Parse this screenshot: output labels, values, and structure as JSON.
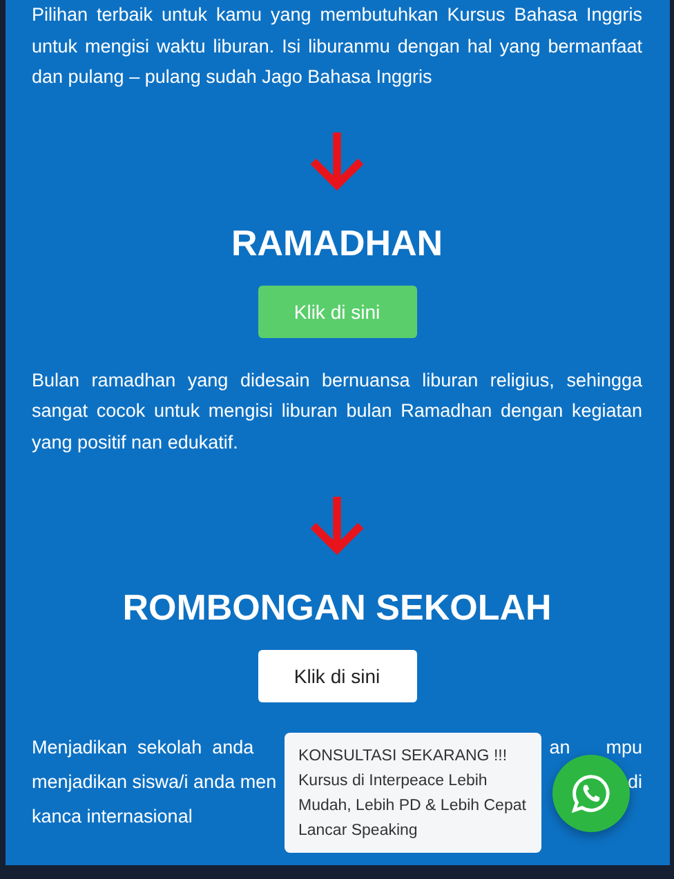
{
  "intro": {
    "text": "Pilihan terbaik untuk kamu yang membutuhkan Kursus Bahasa Inggris untuk mengisi waktu liburan. Isi liburanmu dengan hal yang bermanfaat dan pulang – pulang sudah Jago Bahasa Inggris"
  },
  "sections": [
    {
      "title": "RAMADHAN",
      "button": {
        "label": "Klik di sini",
        "kind": "green"
      },
      "paragraph": {
        "kind": "full",
        "text": "Bulan ramadhan yang didesain bernuansa liburan religius, sehingga sangat cocok untuk mengisi liburan bulan Ramadhan dengan kegiatan yang positif nan edukatif."
      }
    },
    {
      "title": "ROMBONGAN SEKOLAH",
      "button": {
        "label": "Klik di sini",
        "kind": "white"
      },
      "paragraph": {
        "kind": "covered",
        "lines": [
          {
            "left": "Menjadikan  sekolah  anda",
            "right": [
              "an",
              "mpu"
            ]
          },
          {
            "left": "menjadikan siswa/i anda men",
            "right": [
              "di"
            ]
          },
          {
            "left": "kanca internasional"
          }
        ]
      }
    }
  ],
  "chat_popup": {
    "lines": [
      "KONSULTASI SEKARANG !!!",
      "Kursus di Interpeace Lebih",
      "Mudah, Lebih PD & Lebih Cepat",
      "Lancar Speaking"
    ]
  }
}
